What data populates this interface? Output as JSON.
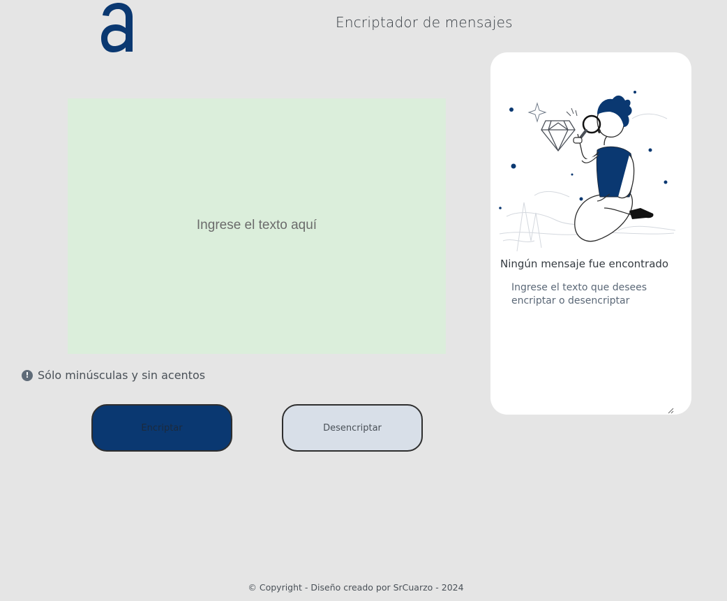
{
  "header": {
    "logo_icon": "alura-a-logo",
    "title": "Encriptador de mensajes"
  },
  "editor": {
    "placeholder": "Ingrese el texto aquí",
    "value": ""
  },
  "hint": {
    "icon": "exclamation-circle-icon",
    "text": "Sólo minúsculas y sin acentos"
  },
  "actions": {
    "encrypt_label": "Encriptar",
    "decrypt_label": "Desencriptar"
  },
  "output": {
    "illustration": "person-with-magnifier-diamond",
    "title": "Ningún mensaje fue encontrado",
    "text": "Ingrese el texto que desees encriptar o desencriptar"
  },
  "footer": {
    "text": "© Copyright - Diseño creado por SrCuarzo - 2024"
  },
  "colors": {
    "background": "#e5e5e5",
    "accent": "#0a3871",
    "editor_bg": "#dbeedb",
    "secondary_button": "#d8dfe8",
    "panel": "#ffffff"
  }
}
